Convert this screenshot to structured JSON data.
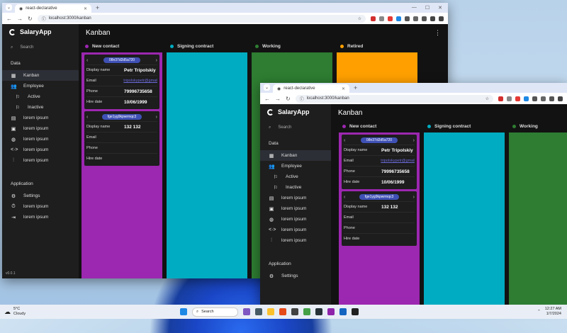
{
  "taskbar": {
    "weather_temp": "5°C",
    "weather_desc": "Cloudy",
    "search_label": "Search",
    "time": "12:27 AM",
    "date": "1/7/2024"
  },
  "browser": {
    "tab_title": "react-declarative",
    "url": "localhost:3000/kanban"
  },
  "app": {
    "name": "SalaryApp",
    "page_title": "Kanban",
    "version": "v0.0.1",
    "search_placeholder": "Search",
    "section_data": "Data",
    "section_application": "Application",
    "menu": {
      "kanban": "Kanban",
      "employee": "Employee",
      "active": "Active",
      "inactive": "Inactive",
      "lorem1": "lorem ipsum",
      "lorem2": "lorem ipsum",
      "lorem3": "lorem ipsum",
      "lorem4": "lorem ipsum",
      "lorem5": "lorem ipsum",
      "settings": "Settings",
      "lorem6": "lorem ipsum",
      "lorem7": "lorem ipsum"
    },
    "columns": {
      "new_contact": {
        "label": "New contact",
        "color": "#9c27b0"
      },
      "signing": {
        "label": "Signing contract",
        "color": "#00acc1"
      },
      "working": {
        "label": "Working",
        "color": "#2e7d32"
      },
      "retired": {
        "label": "Retired",
        "color": "#ffa000"
      }
    },
    "cards": [
      {
        "id": "08n37d2d5a720",
        "fields": {
          "display_name_label": "Display name",
          "display_name": "Petr Tripolskiy",
          "email_label": "Email",
          "email": "tripolskypetr@gmail",
          "phone_label": "Phone",
          "phone": "79996735658",
          "hire_label": "Hire date",
          "hire": "10/06/1999"
        }
      },
      {
        "id": "fge1yg9kpwrmqc3",
        "fields": {
          "display_name_label": "Display name",
          "display_name": "132 132",
          "email_label": "Email",
          "email": "",
          "phone_label": "Phone",
          "phone": "",
          "hire_label": "Hire date",
          "hire": ""
        }
      }
    ]
  }
}
